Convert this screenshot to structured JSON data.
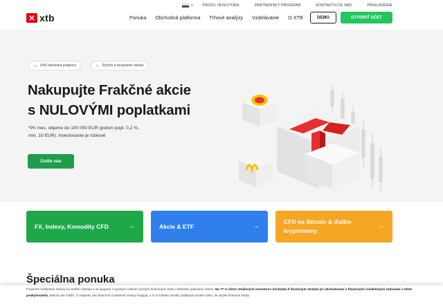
{
  "topbar": {
    "flag_colors": [
      "#ffffff",
      "#0b4ea2",
      "#ee1c25"
    ],
    "links": [
      "PROFIL INVESTORA",
      "PARTNERSKÝ PROGRAM",
      "KONTAKTUJTE NÁS",
      "PRIHLÁSENIE"
    ]
  },
  "logo": {
    "text": "xtb",
    "mark_color": "#e30613"
  },
  "nav": {
    "items": [
      "Ponuka",
      "Obchodná platforma",
      "Trhové analýzy",
      "Vzdelávanie",
      "O XTB"
    ],
    "demo_label": "DEMO",
    "open_label": "OTVORIŤ ÚČET"
  },
  "hero": {
    "pill1": "24/5 klientská podpora",
    "pill2": "Rýchle a bezplatné vklady",
    "title_line1": "Nakupujte Frakčné akcie",
    "title_line2": "s NULOVÝMI poplatkami",
    "sub_line1": "*Pri mes. objeme do 100 000 EUR (potom popl. 0,2 %,",
    "sub_line2": "min. 10 EUR). Investovanie je rizikové",
    "cta_label": "Zistite viac"
  },
  "cards": [
    {
      "label": "FX, Indexy, Komodity CFD",
      "color": "#1fa84a"
    },
    {
      "label": "Akcie & ETF",
      "color": "#2f80ed"
    },
    {
      "label": "CFD na Bitcoin & ďalšie kryptomeny",
      "color": "#f5a623"
    }
  ],
  "special_title": "Špeciálna ponuka",
  "risk": {
    "normal1": "Finančné rozdielové zmluvy sú zložité nástroje a sú spojené s vysokým rizikom rýchlych finančných strát v dôsledku pákového efektu. ",
    "bold1": "Na 77 % účtov retailových investorov dochádza k finančným stratám pri obchodovaní s finančnými rozdielovými zmluvami u tohto poskytovateľa.",
    "normal2": " Mali by ste zvážiť, či chápete, ako finančné rozdielové zmluvy fungujú, a či si môžete dovoliť podstúpiť vysoké riziko, že utrpíte finančné straty."
  }
}
